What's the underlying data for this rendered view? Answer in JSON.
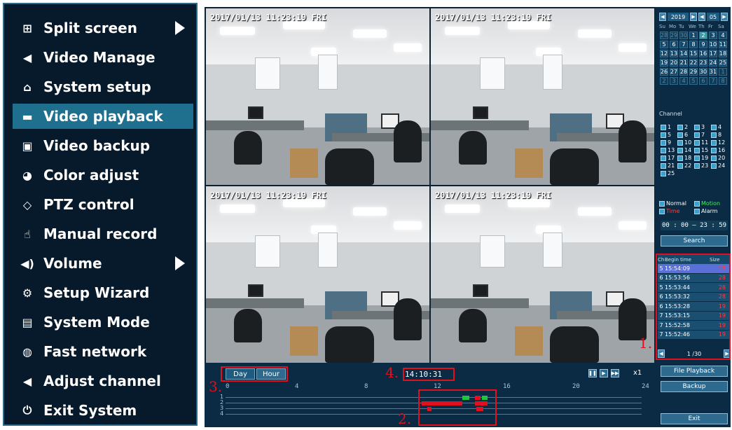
{
  "menu": {
    "items": [
      {
        "label": "Split screen",
        "icon": "grid-icon",
        "glyph": "⊞",
        "submenu": true
      },
      {
        "label": "Video Manage",
        "icon": "camera-icon",
        "glyph": "◀",
        "submenu": false
      },
      {
        "label": "System setup",
        "icon": "home-icon",
        "glyph": "⌂",
        "submenu": false
      },
      {
        "label": "Video playback",
        "icon": "film-icon",
        "glyph": "▬",
        "submenu": false,
        "active": true
      },
      {
        "label": "Video backup",
        "icon": "save-icon",
        "glyph": "▣",
        "submenu": false
      },
      {
        "label": "Color adjust",
        "icon": "palette-icon",
        "glyph": "◕",
        "submenu": false
      },
      {
        "label": "PTZ control",
        "icon": "ptz-icon",
        "glyph": "◇",
        "submenu": false
      },
      {
        "label": "Manual record",
        "icon": "hand-icon",
        "glyph": "☝",
        "submenu": false
      },
      {
        "label": "Volume",
        "icon": "speaker-icon",
        "glyph": "◀)",
        "submenu": true
      },
      {
        "label": "Setup Wizard",
        "icon": "wizard-icon",
        "glyph": "⚙",
        "submenu": false
      },
      {
        "label": "System Mode",
        "icon": "document-icon",
        "glyph": "▤",
        "submenu": false
      },
      {
        "label": "Fast network",
        "icon": "globe-icon",
        "glyph": "◍",
        "submenu": false
      },
      {
        "label": "Adjust channel",
        "icon": "camera-icon",
        "glyph": "◀",
        "submenu": false
      },
      {
        "label": "Exit System",
        "icon": "power-icon",
        "glyph": "⏻",
        "submenu": false
      }
    ]
  },
  "cameras": {
    "timestamp": "2017/01/13 11:23:19 FRI"
  },
  "timeline": {
    "btn_day": "Day",
    "btn_hour": "Hour",
    "current_time": "14:10:31",
    "speed": "x1",
    "ticks": [
      "0",
      "4",
      "8",
      "12",
      "16",
      "20",
      "24"
    ],
    "track_labels": [
      "1",
      "2",
      "3",
      "4"
    ]
  },
  "annotations": {
    "n1": "1.",
    "n2": "2.",
    "n3": "3.",
    "n4": "4."
  },
  "sidebar": {
    "year": "2019",
    "month": "05",
    "weekdays": [
      "Su",
      "Mo",
      "Tu",
      "We",
      "Th",
      "Fr",
      "Sa"
    ],
    "days": [
      "28",
      "29",
      "30",
      "1",
      "2",
      "3",
      "4",
      "5",
      "6",
      "7",
      "8",
      "9",
      "10",
      "11",
      "12",
      "13",
      "14",
      "15",
      "16",
      "17",
      "18",
      "19",
      "20",
      "21",
      "22",
      "23",
      "24",
      "25",
      "26",
      "27",
      "28",
      "29",
      "30",
      "31",
      "1",
      "2",
      "3",
      "4",
      "5",
      "6",
      "7",
      "8"
    ],
    "channel_label": "Channel",
    "channels": [
      "1",
      "2",
      "3",
      "4",
      "5",
      "6",
      "7",
      "8",
      "9",
      "10",
      "11",
      "12",
      "13",
      "14",
      "15",
      "16",
      "17",
      "18",
      "19",
      "20",
      "21",
      "22",
      "23",
      "24",
      "25"
    ],
    "types": [
      "Normal",
      "Motion",
      "Time",
      "Alarm"
    ],
    "time_range": "00 : 00 — 23 : 59",
    "search_btn": "Search",
    "list_headers": {
      "ch": "Ch",
      "begin": "Begin time",
      "size": "Size"
    },
    "files": [
      {
        "ch": "5",
        "time": "15:54:09",
        "size": "28"
      },
      {
        "ch": "6",
        "time": "15:53:56",
        "size": "28"
      },
      {
        "ch": "5",
        "time": "15:53:44",
        "size": "28"
      },
      {
        "ch": "6",
        "time": "15:53:32",
        "size": "28"
      },
      {
        "ch": "6",
        "time": "15:53:28",
        "size": "19"
      },
      {
        "ch": "7",
        "time": "15:53:15",
        "size": "19"
      },
      {
        "ch": "7",
        "time": "15:52:58",
        "size": "19"
      },
      {
        "ch": "7",
        "time": "15:52:46",
        "size": "19"
      }
    ],
    "page": "1",
    "page_total": "/30",
    "file_playback_btn": "File Playback",
    "backup_btn": "Backup",
    "exit_btn": "Exit"
  }
}
